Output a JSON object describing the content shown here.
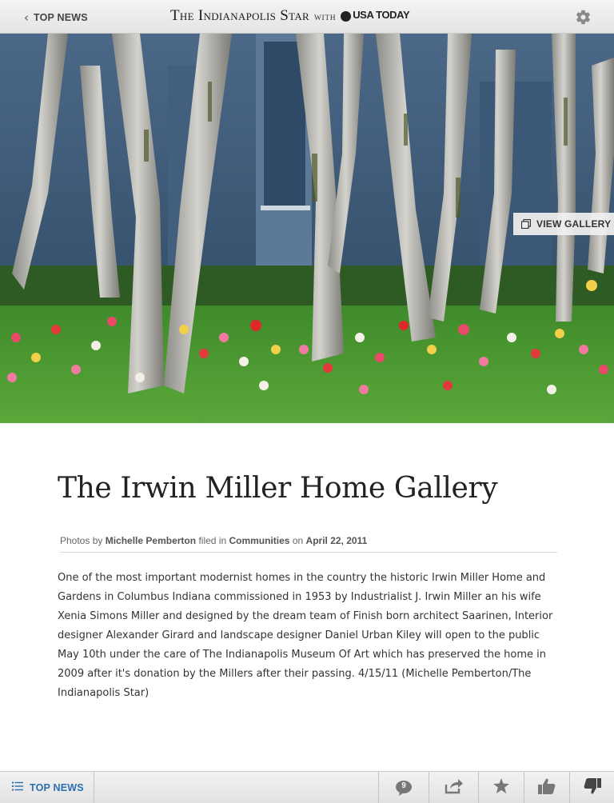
{
  "header": {
    "back_label": "TOP NEWS",
    "masthead_title": "The Indianapolis Star",
    "masthead_with": "WITH",
    "masthead_partner": "USA TODAY",
    "settings_icon": "gear-icon"
  },
  "hero": {
    "view_gallery_label": "VIEW GALLERY",
    "gallery_icon": "gallery-icon"
  },
  "article": {
    "title": "The Irwin Miller Home Gallery",
    "byline": {
      "prefix": "Photos by",
      "author": "Michelle Pemberton",
      "filed_in": "filed in",
      "section": "Communities",
      "on": "on",
      "date": "April 22, 2011"
    },
    "body": "One of the most important modernist homes in the country the historic Irwin Miller Home and Gardens in Columbus Indiana commissioned in 1953 by Industrialist J. Irwin Miller an his wife Xenia Simons Miller and designed by the dream team of Finish born architect Saarinen, Interior designer Alexander Girard and landscape designer Daniel Urban Kiley will open to the public May 10th under the care of The Indianapolis Museum Of Art which has preserved the home in 2009 after it's donation by the Millers after their passing. 4/15/11 (Michelle Pemberton/The Indianapolis Star)"
  },
  "footer": {
    "top_news_label": "TOP NEWS",
    "comment_count": "9",
    "icons": [
      "list-icon",
      "comments-icon",
      "share-icon",
      "star-icon",
      "thumbs-up-icon",
      "thumbs-down-icon"
    ]
  },
  "colors": {
    "accent_blue": "#2a6fb0",
    "bar_gray": "#e8e8e8"
  }
}
